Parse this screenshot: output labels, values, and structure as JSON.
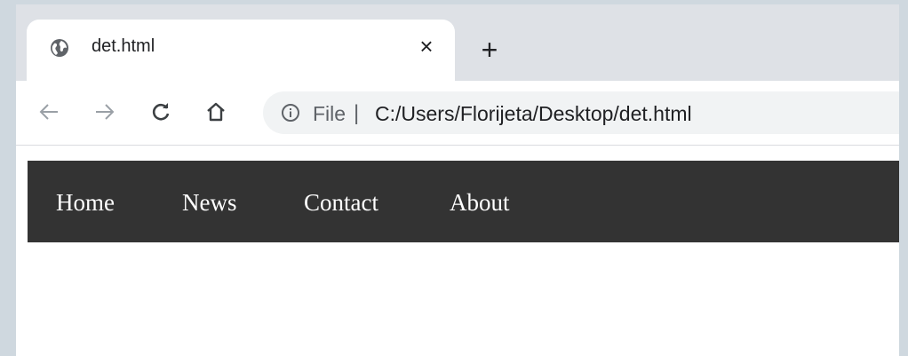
{
  "browser": {
    "tab": {
      "title": "det.html",
      "icon": "globe-icon",
      "close_symbol": "×"
    },
    "new_tab_symbol": "+",
    "toolbar": {
      "back_icon": "arrow-left-icon",
      "forward_icon": "arrow-right-icon",
      "reload_icon": "reload-icon",
      "home_icon": "home-icon"
    },
    "address_bar": {
      "info_icon": "info-icon",
      "scheme_label": "File",
      "separator": "|",
      "url": "C:/Users/Florijeta/Desktop/det.html"
    }
  },
  "page": {
    "nav": {
      "background": "#333333",
      "items": [
        {
          "label": "Home"
        },
        {
          "label": "News"
        },
        {
          "label": "Contact"
        },
        {
          "label": "About"
        }
      ]
    }
  }
}
